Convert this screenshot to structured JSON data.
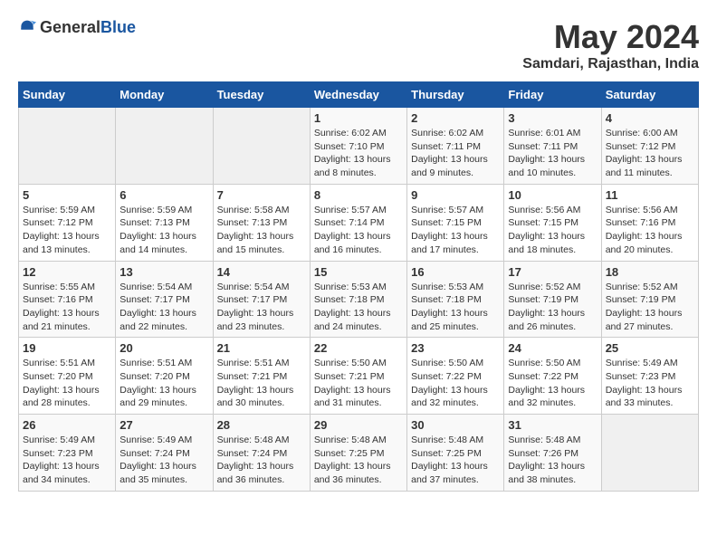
{
  "logo": {
    "general": "General",
    "blue": "Blue"
  },
  "title": "May 2024",
  "subtitle": "Samdari, Rajasthan, India",
  "weekdays": [
    "Sunday",
    "Monday",
    "Tuesday",
    "Wednesday",
    "Thursday",
    "Friday",
    "Saturday"
  ],
  "weeks": [
    [
      {
        "day": "",
        "sunrise": "",
        "sunset": "",
        "daylight": ""
      },
      {
        "day": "",
        "sunrise": "",
        "sunset": "",
        "daylight": ""
      },
      {
        "day": "",
        "sunrise": "",
        "sunset": "",
        "daylight": ""
      },
      {
        "day": "1",
        "sunrise": "Sunrise: 6:02 AM",
        "sunset": "Sunset: 7:10 PM",
        "daylight": "Daylight: 13 hours and 8 minutes."
      },
      {
        "day": "2",
        "sunrise": "Sunrise: 6:02 AM",
        "sunset": "Sunset: 7:11 PM",
        "daylight": "Daylight: 13 hours and 9 minutes."
      },
      {
        "day": "3",
        "sunrise": "Sunrise: 6:01 AM",
        "sunset": "Sunset: 7:11 PM",
        "daylight": "Daylight: 13 hours and 10 minutes."
      },
      {
        "day": "4",
        "sunrise": "Sunrise: 6:00 AM",
        "sunset": "Sunset: 7:12 PM",
        "daylight": "Daylight: 13 hours and 11 minutes."
      }
    ],
    [
      {
        "day": "5",
        "sunrise": "Sunrise: 5:59 AM",
        "sunset": "Sunset: 7:12 PM",
        "daylight": "Daylight: 13 hours and 13 minutes."
      },
      {
        "day": "6",
        "sunrise": "Sunrise: 5:59 AM",
        "sunset": "Sunset: 7:13 PM",
        "daylight": "Daylight: 13 hours and 14 minutes."
      },
      {
        "day": "7",
        "sunrise": "Sunrise: 5:58 AM",
        "sunset": "Sunset: 7:13 PM",
        "daylight": "Daylight: 13 hours and 15 minutes."
      },
      {
        "day": "8",
        "sunrise": "Sunrise: 5:57 AM",
        "sunset": "Sunset: 7:14 PM",
        "daylight": "Daylight: 13 hours and 16 minutes."
      },
      {
        "day": "9",
        "sunrise": "Sunrise: 5:57 AM",
        "sunset": "Sunset: 7:15 PM",
        "daylight": "Daylight: 13 hours and 17 minutes."
      },
      {
        "day": "10",
        "sunrise": "Sunrise: 5:56 AM",
        "sunset": "Sunset: 7:15 PM",
        "daylight": "Daylight: 13 hours and 18 minutes."
      },
      {
        "day": "11",
        "sunrise": "Sunrise: 5:56 AM",
        "sunset": "Sunset: 7:16 PM",
        "daylight": "Daylight: 13 hours and 20 minutes."
      }
    ],
    [
      {
        "day": "12",
        "sunrise": "Sunrise: 5:55 AM",
        "sunset": "Sunset: 7:16 PM",
        "daylight": "Daylight: 13 hours and 21 minutes."
      },
      {
        "day": "13",
        "sunrise": "Sunrise: 5:54 AM",
        "sunset": "Sunset: 7:17 PM",
        "daylight": "Daylight: 13 hours and 22 minutes."
      },
      {
        "day": "14",
        "sunrise": "Sunrise: 5:54 AM",
        "sunset": "Sunset: 7:17 PM",
        "daylight": "Daylight: 13 hours and 23 minutes."
      },
      {
        "day": "15",
        "sunrise": "Sunrise: 5:53 AM",
        "sunset": "Sunset: 7:18 PM",
        "daylight": "Daylight: 13 hours and 24 minutes."
      },
      {
        "day": "16",
        "sunrise": "Sunrise: 5:53 AM",
        "sunset": "Sunset: 7:18 PM",
        "daylight": "Daylight: 13 hours and 25 minutes."
      },
      {
        "day": "17",
        "sunrise": "Sunrise: 5:52 AM",
        "sunset": "Sunset: 7:19 PM",
        "daylight": "Daylight: 13 hours and 26 minutes."
      },
      {
        "day": "18",
        "sunrise": "Sunrise: 5:52 AM",
        "sunset": "Sunset: 7:19 PM",
        "daylight": "Daylight: 13 hours and 27 minutes."
      }
    ],
    [
      {
        "day": "19",
        "sunrise": "Sunrise: 5:51 AM",
        "sunset": "Sunset: 7:20 PM",
        "daylight": "Daylight: 13 hours and 28 minutes."
      },
      {
        "day": "20",
        "sunrise": "Sunrise: 5:51 AM",
        "sunset": "Sunset: 7:20 PM",
        "daylight": "Daylight: 13 hours and 29 minutes."
      },
      {
        "day": "21",
        "sunrise": "Sunrise: 5:51 AM",
        "sunset": "Sunset: 7:21 PM",
        "daylight": "Daylight: 13 hours and 30 minutes."
      },
      {
        "day": "22",
        "sunrise": "Sunrise: 5:50 AM",
        "sunset": "Sunset: 7:21 PM",
        "daylight": "Daylight: 13 hours and 31 minutes."
      },
      {
        "day": "23",
        "sunrise": "Sunrise: 5:50 AM",
        "sunset": "Sunset: 7:22 PM",
        "daylight": "Daylight: 13 hours and 32 minutes."
      },
      {
        "day": "24",
        "sunrise": "Sunrise: 5:50 AM",
        "sunset": "Sunset: 7:22 PM",
        "daylight": "Daylight: 13 hours and 32 minutes."
      },
      {
        "day": "25",
        "sunrise": "Sunrise: 5:49 AM",
        "sunset": "Sunset: 7:23 PM",
        "daylight": "Daylight: 13 hours and 33 minutes."
      }
    ],
    [
      {
        "day": "26",
        "sunrise": "Sunrise: 5:49 AM",
        "sunset": "Sunset: 7:23 PM",
        "daylight": "Daylight: 13 hours and 34 minutes."
      },
      {
        "day": "27",
        "sunrise": "Sunrise: 5:49 AM",
        "sunset": "Sunset: 7:24 PM",
        "daylight": "Daylight: 13 hours and 35 minutes."
      },
      {
        "day": "28",
        "sunrise": "Sunrise: 5:48 AM",
        "sunset": "Sunset: 7:24 PM",
        "daylight": "Daylight: 13 hours and 36 minutes."
      },
      {
        "day": "29",
        "sunrise": "Sunrise: 5:48 AM",
        "sunset": "Sunset: 7:25 PM",
        "daylight": "Daylight: 13 hours and 36 minutes."
      },
      {
        "day": "30",
        "sunrise": "Sunrise: 5:48 AM",
        "sunset": "Sunset: 7:25 PM",
        "daylight": "Daylight: 13 hours and 37 minutes."
      },
      {
        "day": "31",
        "sunrise": "Sunrise: 5:48 AM",
        "sunset": "Sunset: 7:26 PM",
        "daylight": "Daylight: 13 hours and 38 minutes."
      },
      {
        "day": "",
        "sunrise": "",
        "sunset": "",
        "daylight": ""
      }
    ]
  ]
}
